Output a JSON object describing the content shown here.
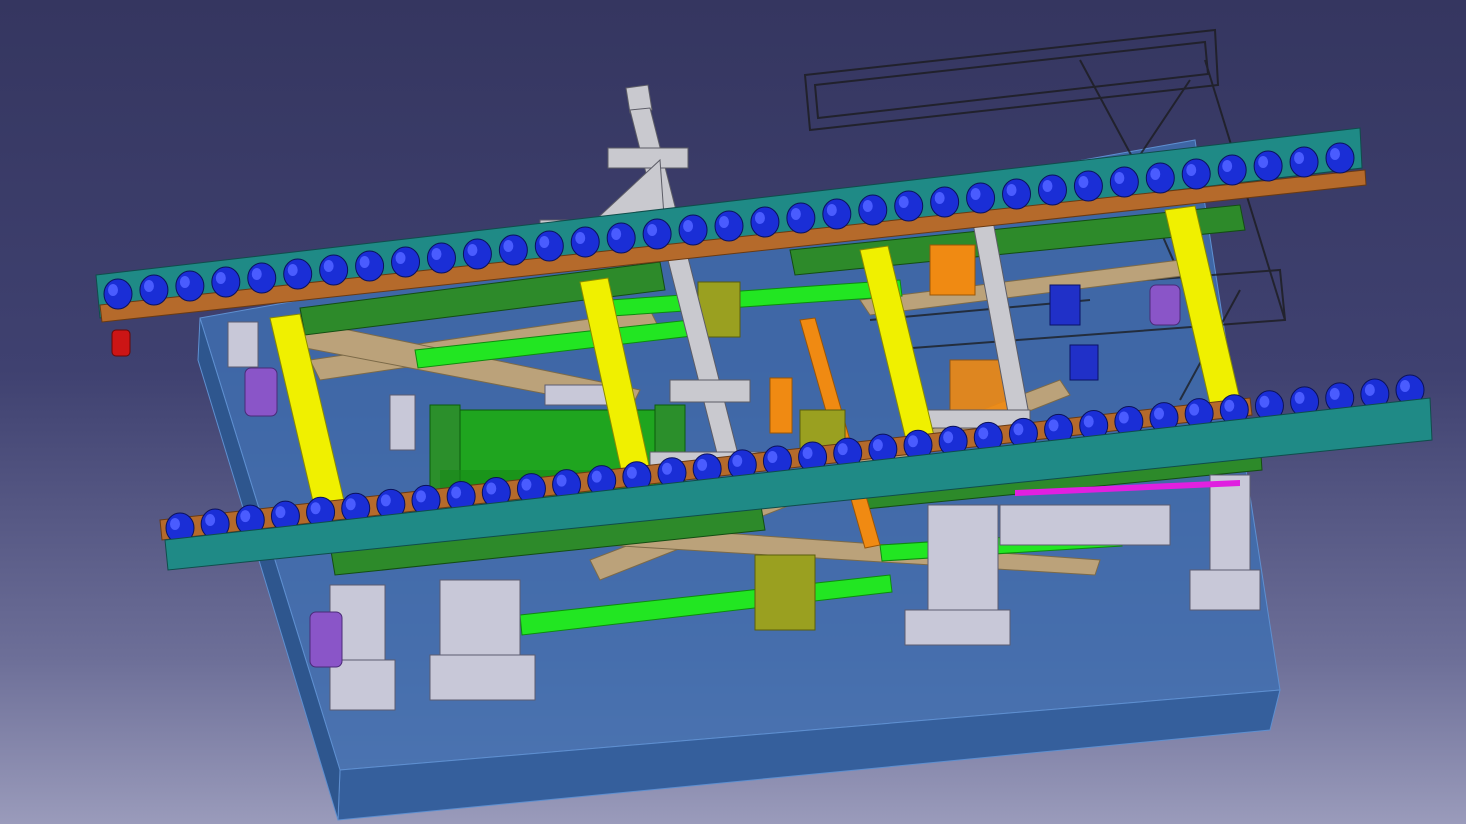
{
  "viewer": {
    "background_top": "#353660",
    "background_bottom": "#9a9bbb"
  },
  "model": {
    "part_colors": {
      "base_plate": "#3f6fb0",
      "conveyor_rail": "#1f8a86",
      "conveyor_bracket": "#b56a2b",
      "roller": "#1a2ed6",
      "roller_cap": "#4a5cff",
      "upright_post": "#f0f000",
      "frame_arm": "#2d8a2a",
      "pneumatic_cylinder": "#1fa51f",
      "guide_rail": "#22e622",
      "scissor_link": "#bba27a",
      "support_bracket": "#c8c8d8",
      "center_column": "#c9c9cf",
      "actuator_orange": "#f08a12",
      "gearbox_olive": "#9aa020",
      "motor_purple": "#8a55c8",
      "stop_red": "#cc1515",
      "magenta_strip": "#e020e0",
      "ghost_frame": "#2b2b2b"
    },
    "icons": [
      "roller-icon",
      "cylinder-icon",
      "bolt-icon"
    ]
  }
}
